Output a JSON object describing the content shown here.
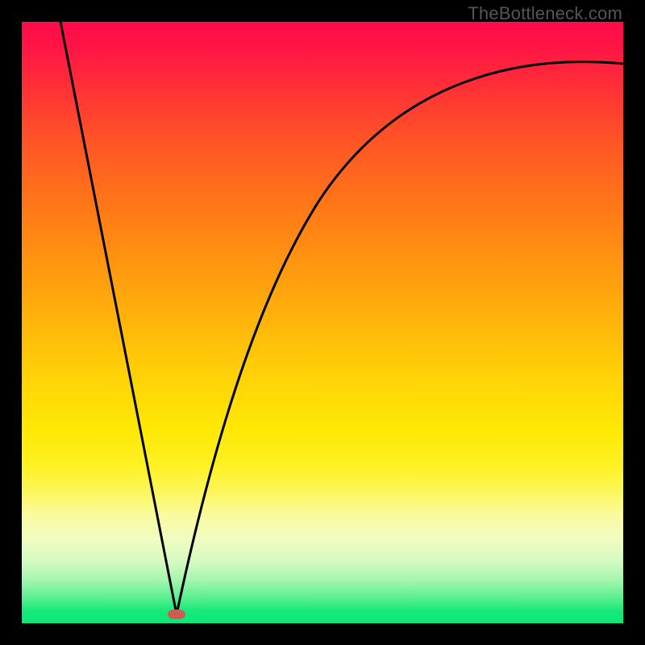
{
  "attribution": "TheBottleneck.com",
  "colors": {
    "frame_border": "#000000",
    "sweet_spot": "#cf5b55",
    "curve": "#000000"
  },
  "sweet_spot": {
    "x_fraction": 0.257,
    "y_fraction": 0.985
  },
  "chart_data": {
    "type": "line",
    "title": "",
    "xlabel": "",
    "ylabel": "",
    "xlim": [
      0,
      100
    ],
    "ylim": [
      0,
      100
    ],
    "series": [
      {
        "name": "bottleneck-curve-left",
        "x": [
          6.5,
          10,
          14,
          18,
          22,
          25.7
        ],
        "values": [
          100,
          83,
          64,
          45,
          26,
          1.5
        ]
      },
      {
        "name": "bottleneck-curve-right",
        "x": [
          25.7,
          28,
          31,
          35,
          40,
          46,
          54,
          64,
          76,
          88,
          100
        ],
        "values": [
          1.5,
          14,
          30,
          47,
          60,
          71,
          79,
          85,
          89,
          91.5,
          93
        ]
      }
    ],
    "annotations": [
      {
        "name": "sweet-spot-marker",
        "x": 25.7,
        "y": 1.5
      }
    ]
  }
}
